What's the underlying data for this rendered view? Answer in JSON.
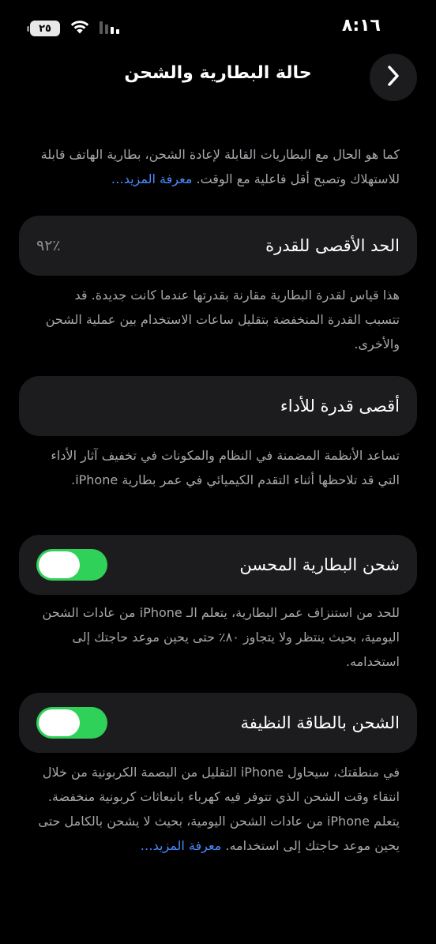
{
  "status_bar": {
    "time": "٨:١٦",
    "battery_level": "٢٥",
    "icons": [
      "battery-icon",
      "wifi-icon",
      "cellular-signal-icon"
    ]
  },
  "nav": {
    "title": "حالة البطارية والشحن",
    "back_icon": "chevron-right-icon"
  },
  "intro": {
    "text": "كما هو الحال مع البطاريات القابلة لإعادة الشحن، بطارية الهاتف قابلة للاستهلاك وتصبح أقل فاعلية مع الوقت.",
    "link": "معرفة المزيد…"
  },
  "max_capacity": {
    "label": "الحد الأقصى للقدرة",
    "value": "٪٩٢",
    "description": "هذا قياس لقدرة البطارية مقارنة بقدرتها عندما كانت جديدة. قد تتسبب القدرة المنخفضة بتقليل ساعات الاستخدام بين عملية الشحن والأخرى."
  },
  "peak_performance": {
    "label": "أقصى قدرة للأداء",
    "description": "تساعد الأنظمة المضمنة في النظام والمكونات في تخفيف آثار الأداء التي قد تلاحظها أثناء التقدم الكيميائي في عمر بطارية iPhone."
  },
  "optimized_charging": {
    "label": "شحن البطارية المحسن",
    "enabled": true,
    "description": "للحد من استنزاف عمر البطارية، يتعلم الـ iPhone من عادات الشحن اليومية، بحيث ينتظر ولا يتجاوز ٨٠٪ حتى يحين موعد حاجتك إلى استخدامه."
  },
  "clean_energy": {
    "label": "الشحن بالطاقة النظيفة",
    "enabled": true,
    "description": "في منطقتك، سيحاول iPhone التقليل من البصمة الكربونية من خلال انتقاء وقت الشحن الذي تتوفر فيه كهرباء بانبعاثات كربونية منخفضة. يتعلم iPhone من عادات الشحن اليومية، بحيث لا يشحن بالكامل حتى يحين موعد حاجتك إلى استخدامه.",
    "link": "معرفة المزيد…"
  },
  "colors": {
    "background": "#000000",
    "card": "#1c1c1e",
    "toggle_on": "#30d158",
    "link": "#4a8cff",
    "secondary_text": "#a8a8ad"
  }
}
